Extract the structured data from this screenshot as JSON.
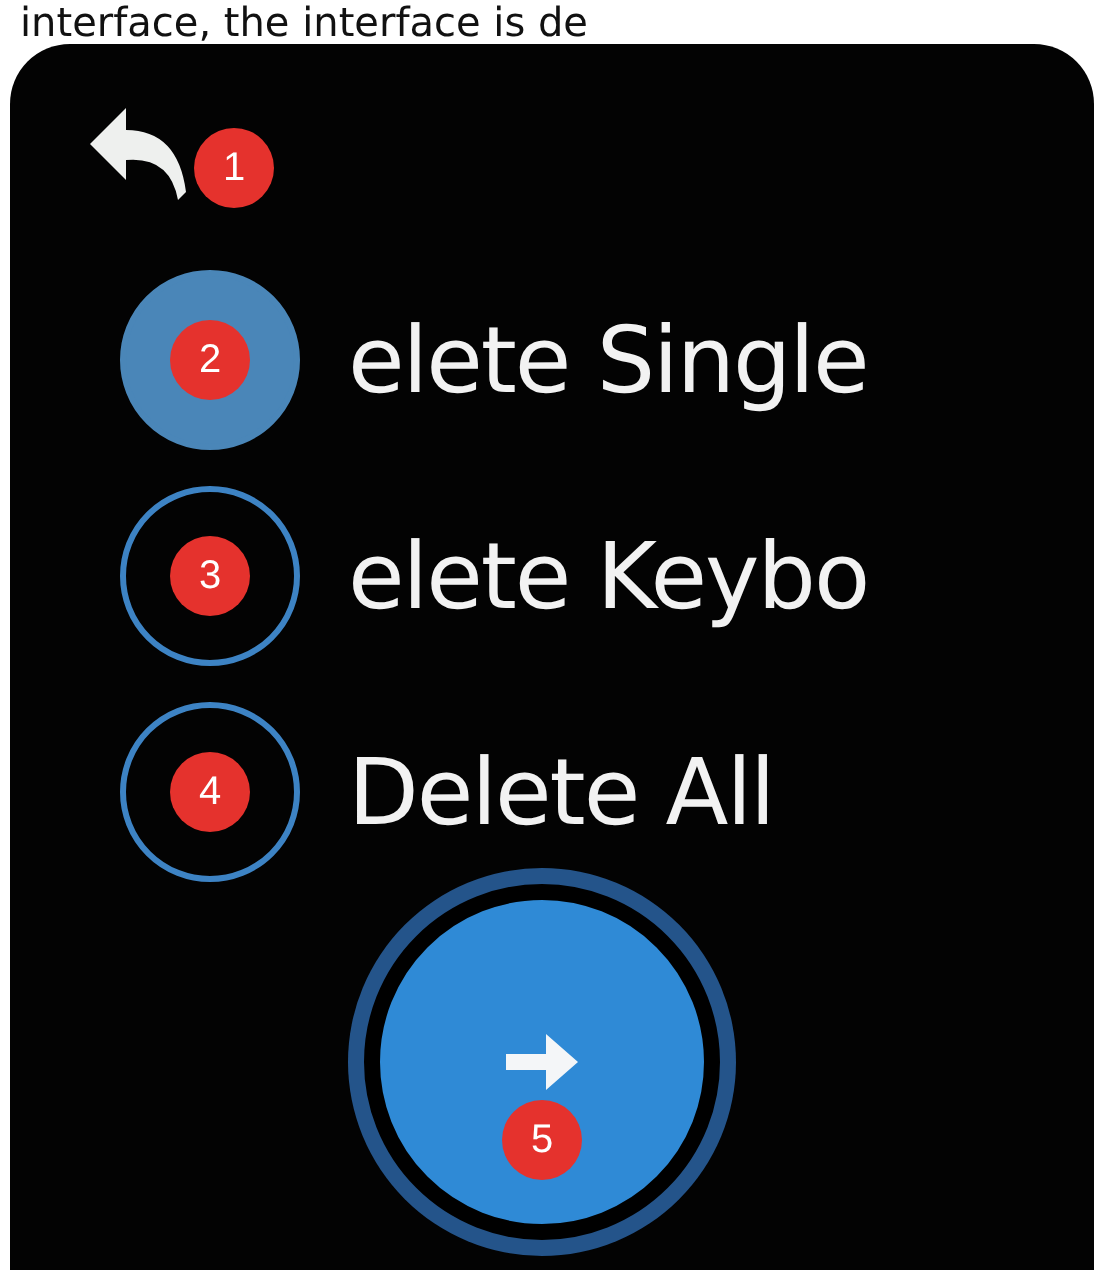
{
  "caption": "interface, the interface is de",
  "back": {
    "badge": "1"
  },
  "options": [
    {
      "label": "elete Single",
      "badge": "2",
      "selected": true
    },
    {
      "label": "elete Keybo",
      "badge": "3",
      "selected": false
    },
    {
      "label": "Delete All",
      "badge": "4",
      "selected": false
    }
  ],
  "confirm": {
    "badge": "5"
  }
}
